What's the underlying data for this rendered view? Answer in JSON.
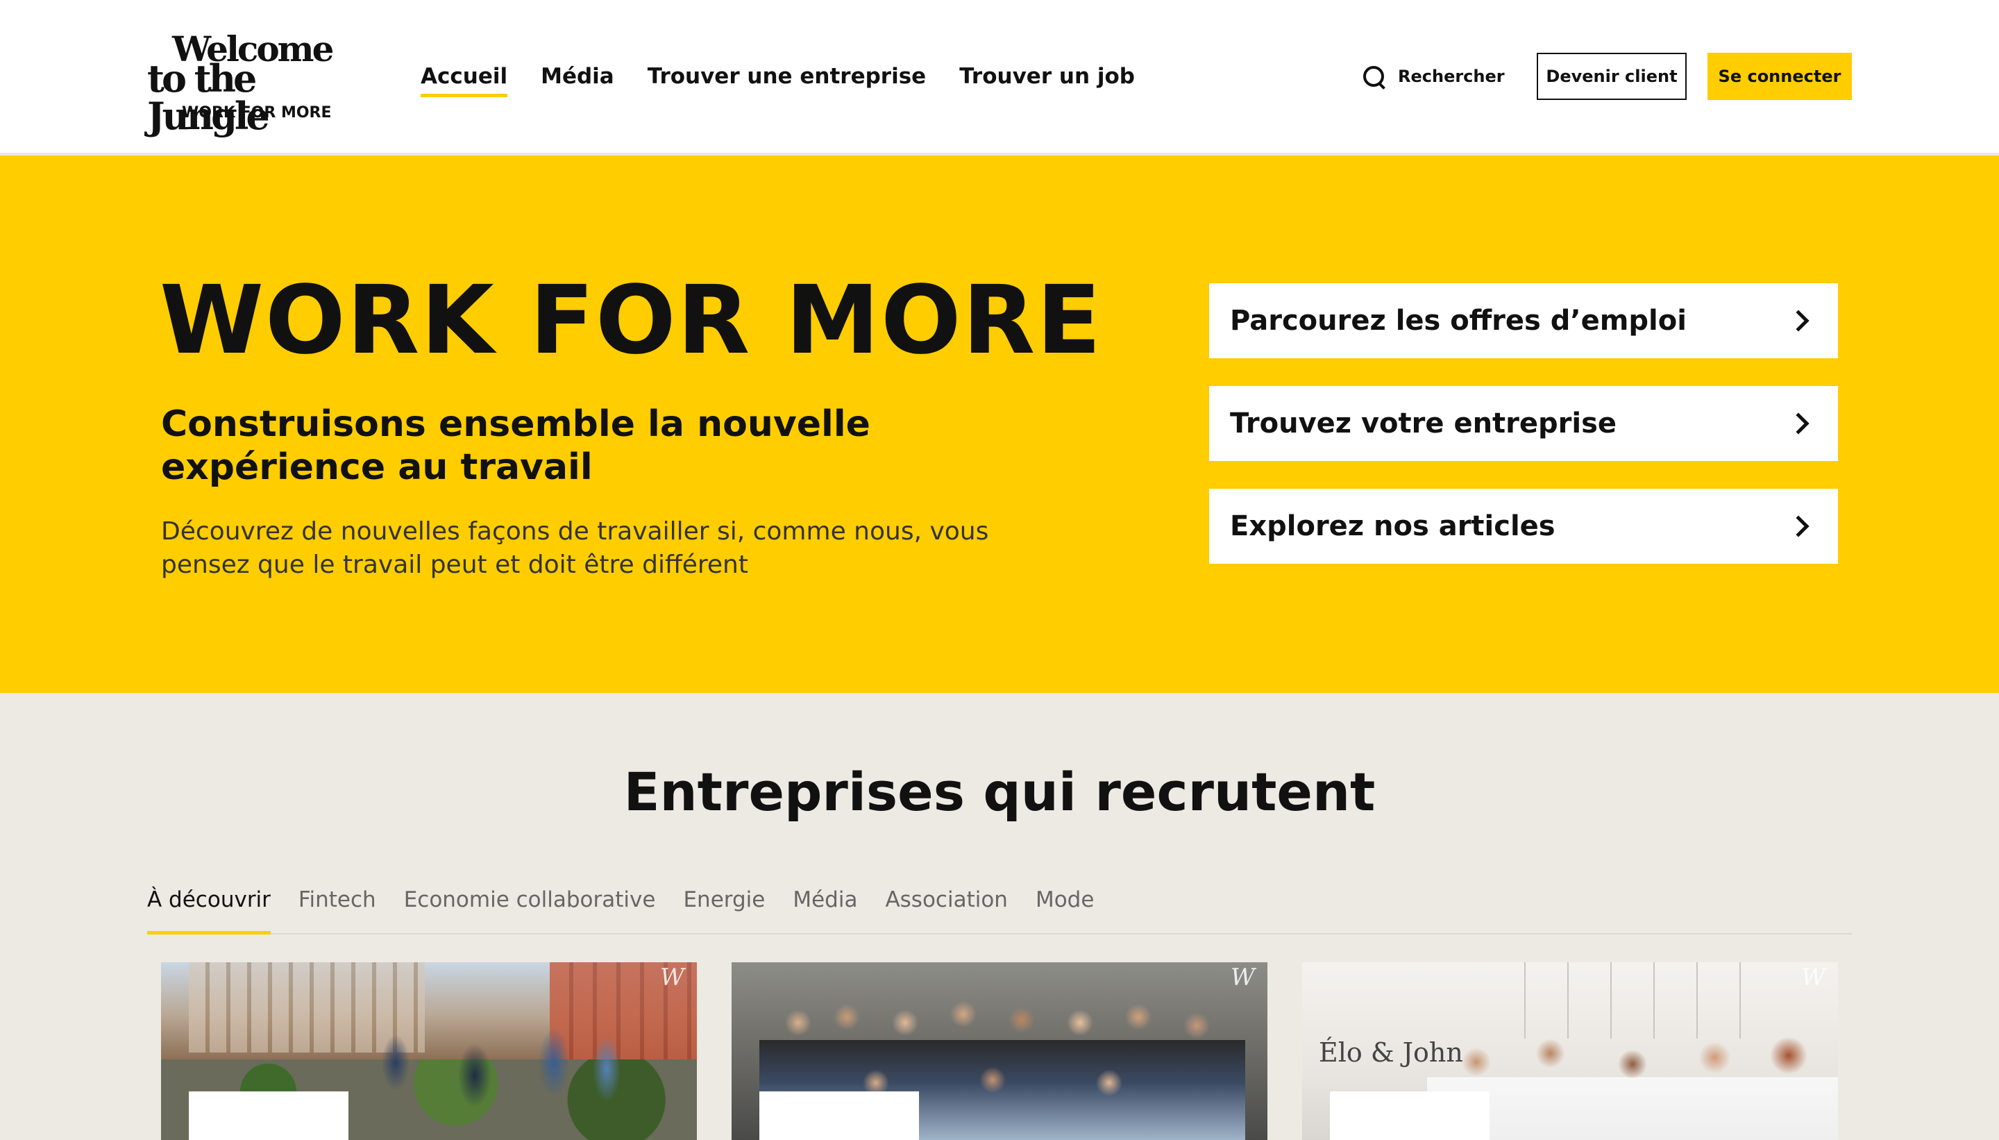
{
  "header": {
    "logo": {
      "line1": "Welcome",
      "line2": "to the Jungle",
      "tagline": "WORK FOR MORE"
    },
    "nav": [
      {
        "label": "Accueil",
        "active": true
      },
      {
        "label": "Média",
        "active": false
      },
      {
        "label": "Trouver une entreprise",
        "active": false
      },
      {
        "label": "Trouver un job",
        "active": false
      }
    ],
    "search_label": "Rechercher",
    "client_button": "Devenir client",
    "login_button": "Se connecter"
  },
  "hero": {
    "title": "WORK FOR MORE",
    "subtitle": "Construisons ensemble la nouvelle expérience au travail",
    "description": "Découvrez de nouvelles façons de travailler si, comme nous, vous pensez que le travail peut et doit être différent",
    "links": [
      {
        "label": "Parcourez les offres d’emploi"
      },
      {
        "label": "Trouvez votre entreprise"
      },
      {
        "label": "Explorez nos articles"
      }
    ]
  },
  "companies": {
    "title": "Entreprises qui recrutent",
    "tabs": [
      {
        "label": "À découvrir",
        "active": true
      },
      {
        "label": "Fintech",
        "active": false
      },
      {
        "label": "Economie collaborative",
        "active": false
      },
      {
        "label": "Energie",
        "active": false
      },
      {
        "label": "Média",
        "active": false
      },
      {
        "label": "Association",
        "active": false
      },
      {
        "label": "Mode",
        "active": false
      }
    ],
    "cards": [
      {
        "corner_mark": "W"
      },
      {
        "corner_mark": "W"
      },
      {
        "corner_mark": "W",
        "sign": "Élo & John"
      }
    ]
  },
  "colors": {
    "brand_yellow": "#ffcd00",
    "text_dark": "#111111",
    "section_background": "#ede9e3"
  },
  "icons": {
    "search": "search-icon",
    "chevron": "chevron-right-icon"
  }
}
